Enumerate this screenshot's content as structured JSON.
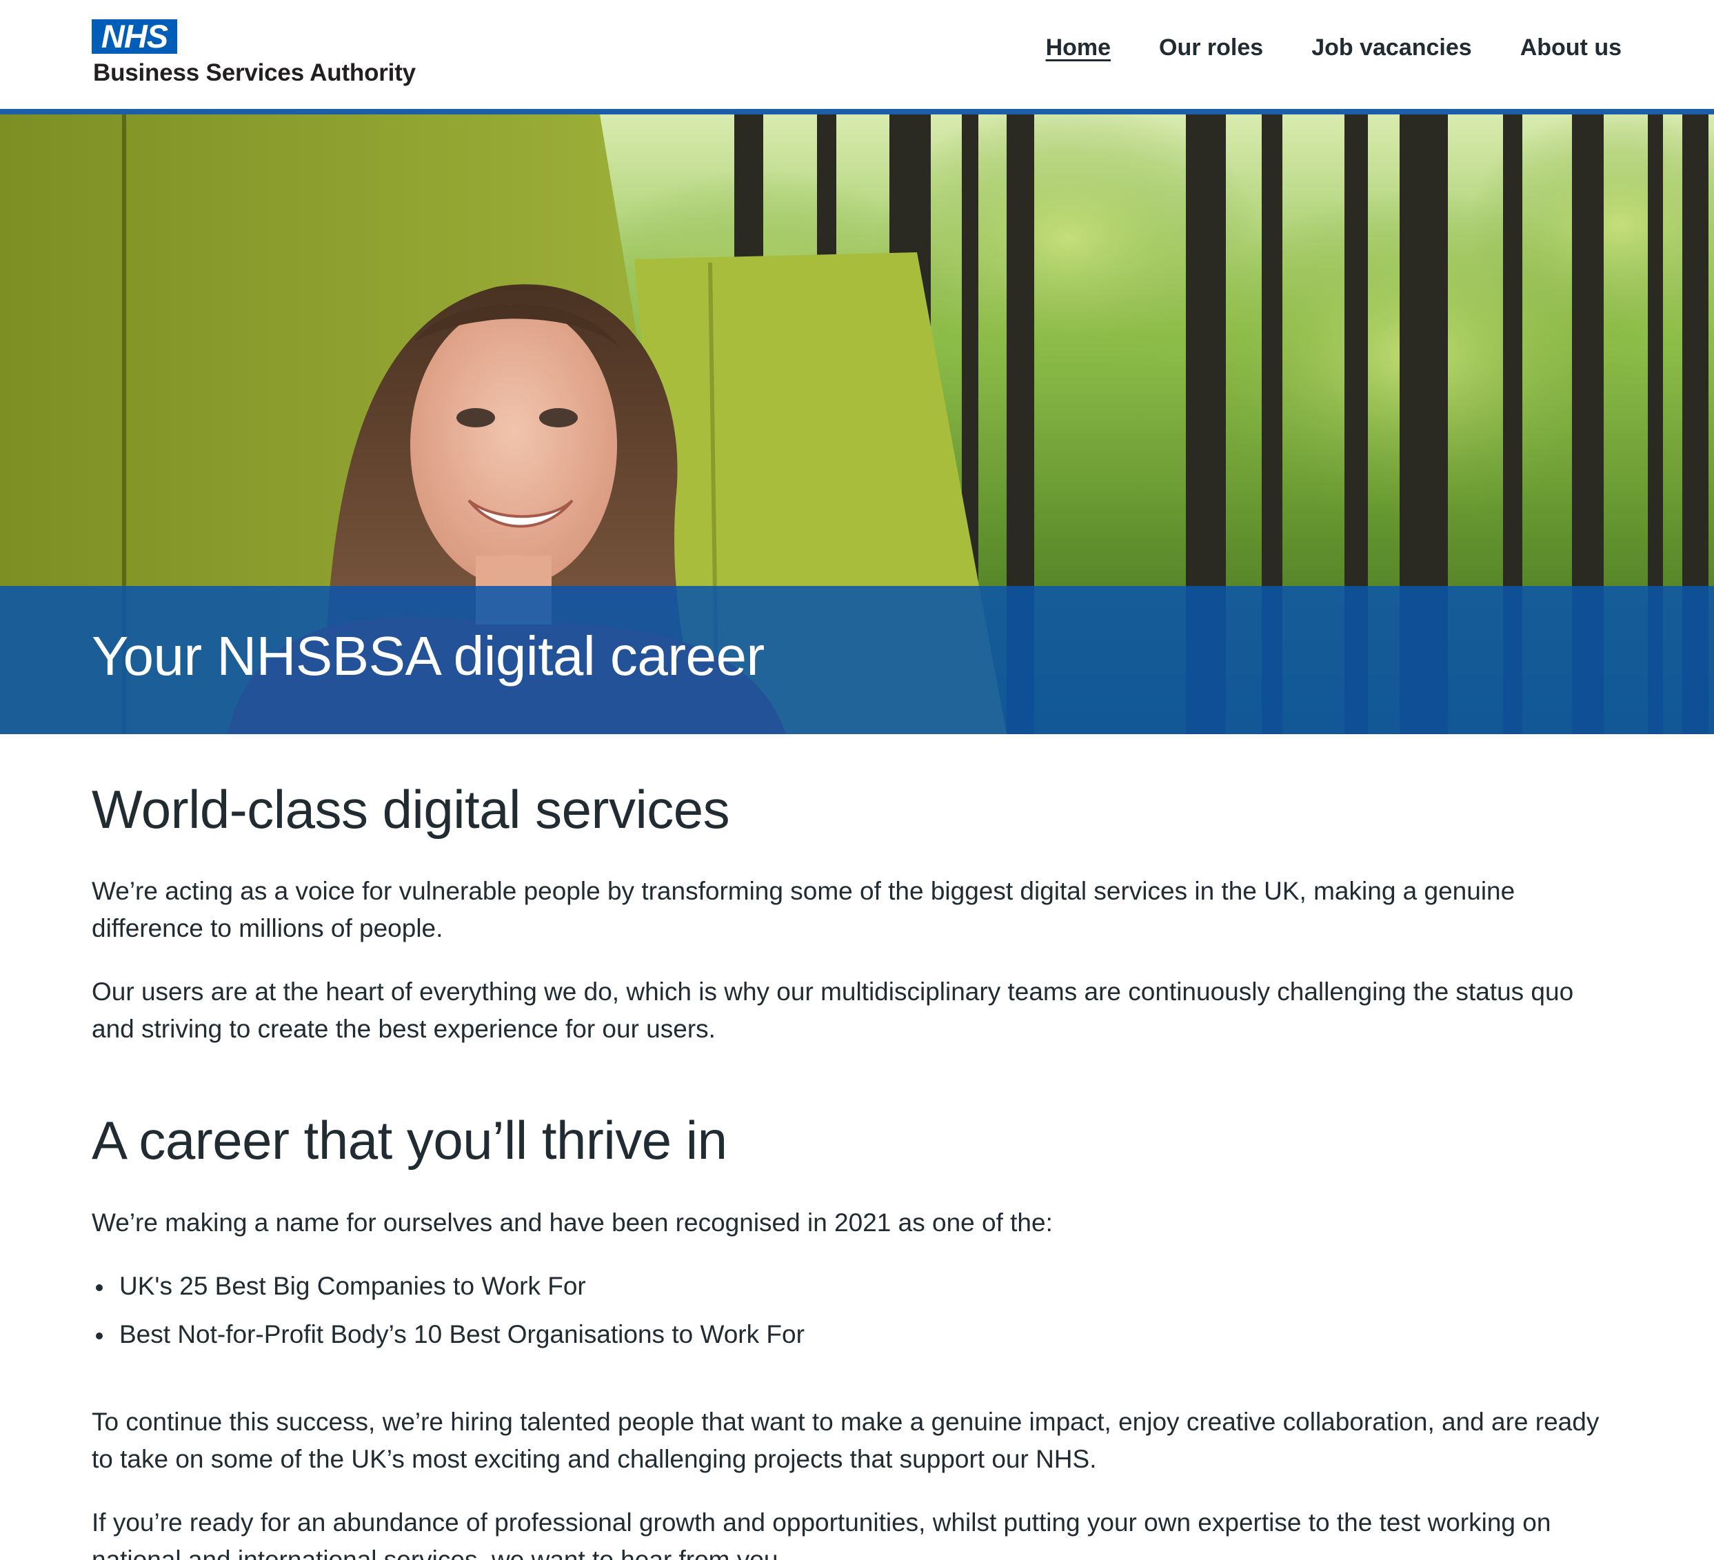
{
  "header": {
    "logo_mark": "NHS",
    "logo_org": "Business Services Authority",
    "nav": [
      {
        "label": "Home",
        "active": true
      },
      {
        "label": "Our roles",
        "active": false
      },
      {
        "label": "Job vacancies",
        "active": false
      },
      {
        "label": "About us",
        "active": false
      }
    ]
  },
  "hero": {
    "title": "Your NHSBSA digital career",
    "image": "smiling woman seated on green booth seating in front of a forest wall mural",
    "band_color": "#1d5ea8"
  },
  "sections": {
    "worldclass": {
      "heading": "World-class digital services",
      "paragraphs": [
        "We’re acting as a voice for vulnerable people by transforming some of the biggest digital services in the UK, making a genuine difference to millions of people.",
        "Our users are at the heart of everything we do, which is why our multidisciplinary teams are continuously challenging the status quo and striving to create the best experience for our users."
      ]
    },
    "career": {
      "heading": "A career that you’ll thrive in",
      "intro": "We’re making a name for ourselves and have been recognised in 2021 as one of the:",
      "awards": [
        "UK's 25 Best Big Companies to Work For",
        "Best Not-for-Profit Body’s 10 Best Organisations to Work For"
      ],
      "paragraphs": [
        "To continue this success, we’re hiring talented people that want to make a genuine impact, enjoy creative collaboration, and are ready to take on some of the UK’s most exciting and challenging projects that support our NHS.",
        "If you’re ready for an abundance of professional growth and opportunities, whilst putting your own expertise to the test working on national and international services, we want to hear from you."
      ]
    }
  },
  "colors": {
    "nhs_blue": "#005eb8",
    "rule_blue": "#1d5ea8",
    "text": "#212b32"
  }
}
